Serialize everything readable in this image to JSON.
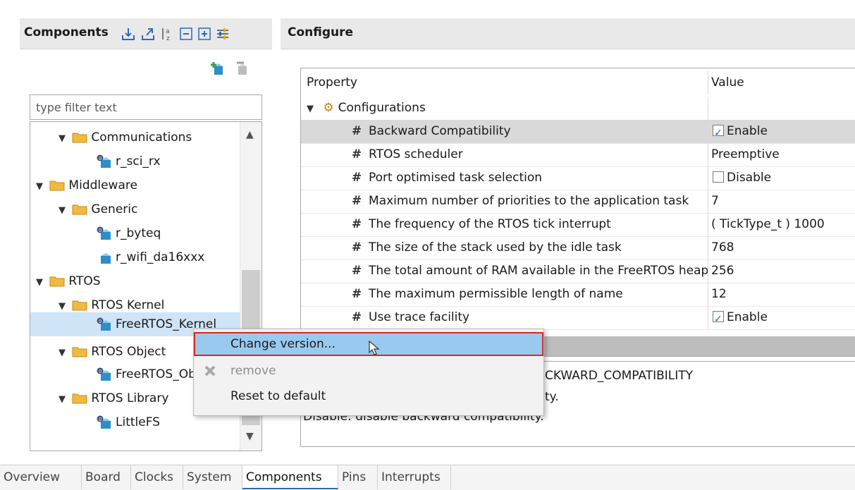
{
  "left_panel": {
    "title": "Components",
    "filter_placeholder": "type filter text",
    "tree": [
      {
        "label": "Communications",
        "kind": "folder",
        "expanded": true
      },
      {
        "label": "r_sci_rx",
        "kind": "component"
      },
      {
        "label": "Middleware",
        "kind": "folder",
        "expanded": true
      },
      {
        "label": "Generic",
        "kind": "folder",
        "expanded": true
      },
      {
        "label": "r_byteq",
        "kind": "component"
      },
      {
        "label": "r_wifi_da16xxx",
        "kind": "component"
      },
      {
        "label": "RTOS",
        "kind": "folder",
        "expanded": true
      },
      {
        "label": "RTOS Kernel",
        "kind": "folder",
        "expanded": true
      },
      {
        "label": "FreeRTOS_Kernel",
        "kind": "component",
        "selected": true
      },
      {
        "label": "RTOS Object",
        "kind": "folder",
        "expanded": true
      },
      {
        "label": "FreeRTOS_Object",
        "kind": "component"
      },
      {
        "label": "RTOS Library",
        "kind": "folder",
        "expanded": true
      },
      {
        "label": "LittleFS",
        "kind": "component"
      }
    ]
  },
  "right_panel": {
    "title": "Configure",
    "table": {
      "col_property": "Property",
      "col_value": "Value",
      "group": "Configurations",
      "rows": [
        {
          "name": "Backward Compatibility",
          "value": "Enable",
          "checkbox": true,
          "checked": true
        },
        {
          "name": "RTOS scheduler",
          "value": "Preemptive"
        },
        {
          "name": "Port optimised task selection",
          "value": "Disable",
          "checkbox": true,
          "checked": false
        },
        {
          "name": "Maximum number of priorities to the application task",
          "value": "7"
        },
        {
          "name": "The frequency of the RTOS tick interrupt",
          "value": "( TickType_t ) 1000"
        },
        {
          "name": "The size of the stack used by the idle task",
          "value": "768"
        },
        {
          "name": "The total amount of RAM available in the FreeRTOS heap",
          "value": "256"
        },
        {
          "name": "The maximum permissible length of name",
          "value": "12"
        },
        {
          "name": "Use trace facility",
          "value": "Enable",
          "checkbox": true,
          "checked": true
        }
      ]
    },
    "description": {
      "line1": "CKWARD_COMPATIBILITY",
      "line2": "ty.",
      "line3": "Disable: disable backward compatibility."
    }
  },
  "context_menu": {
    "change_version": "Change version...",
    "remove": "remove",
    "reset": "Reset to default"
  },
  "tabs": [
    "Overview",
    "Board",
    "Clocks",
    "System",
    "Components",
    "Pins",
    "Interrupts"
  ],
  "active_tab": "Components",
  "colors": {
    "accent": "#2a6bbf",
    "menu_hover": "#99c9ef",
    "highlight_border": "#d9281c",
    "folder": "#f0b93f"
  }
}
